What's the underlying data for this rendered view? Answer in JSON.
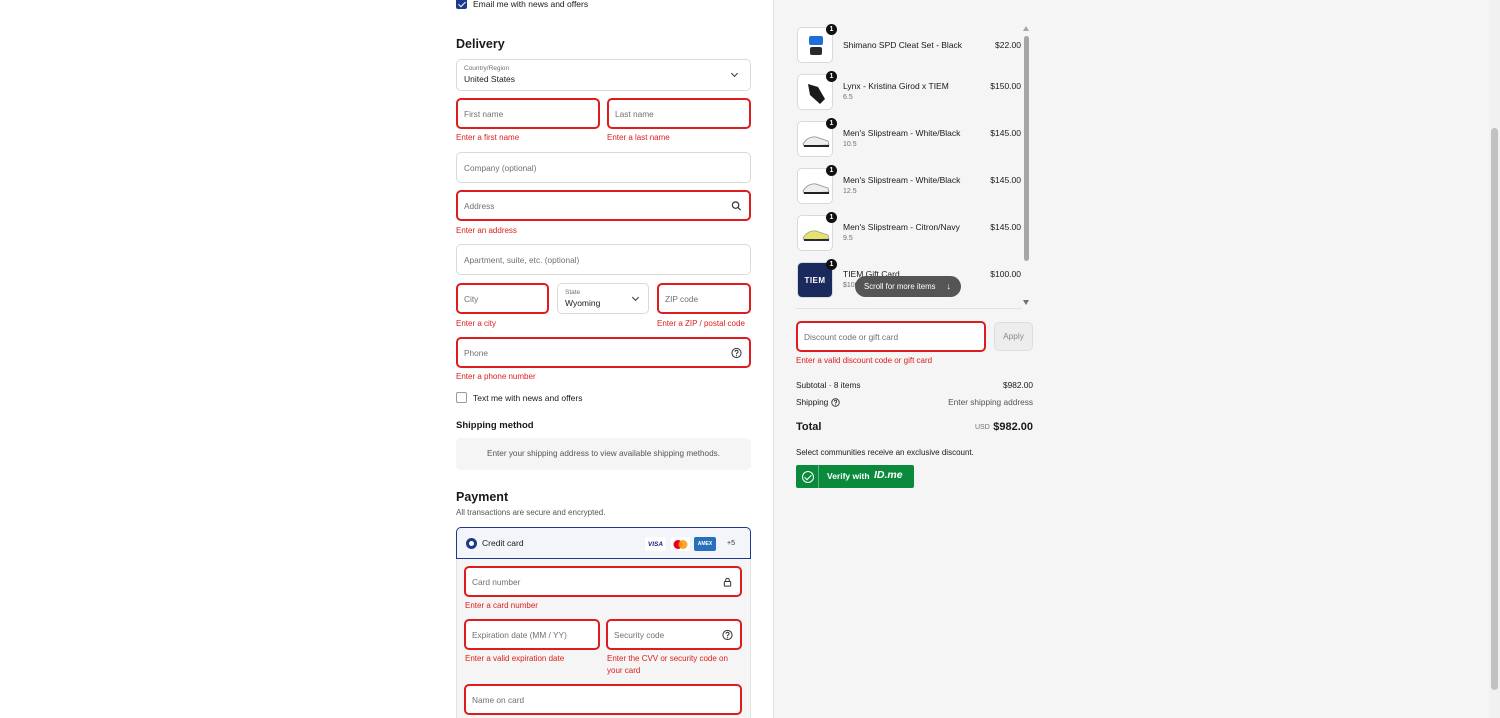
{
  "contact": {
    "email_optin_label": "Email me with news and offers",
    "email_optin_checked": true
  },
  "delivery": {
    "heading": "Delivery",
    "country": {
      "label": "Country/Region",
      "value": "United States"
    },
    "first_name": {
      "placeholder": "First name",
      "error": "Enter a first name"
    },
    "last_name": {
      "placeholder": "Last name",
      "error": "Enter a last name"
    },
    "company": {
      "placeholder": "Company (optional)"
    },
    "address": {
      "placeholder": "Address",
      "error": "Enter an address"
    },
    "apartment": {
      "placeholder": "Apartment, suite, etc. (optional)"
    },
    "city": {
      "placeholder": "City",
      "error": "Enter a city"
    },
    "state": {
      "label": "State",
      "value": "Wyoming"
    },
    "zip": {
      "placeholder": "ZIP code",
      "error": "Enter a ZIP / postal code"
    },
    "phone": {
      "placeholder": "Phone",
      "error": "Enter a phone number"
    },
    "sms_optin_label": "Text me with news and offers",
    "sms_optin_checked": false
  },
  "shipping": {
    "heading": "Shipping method",
    "message": "Enter your shipping address to view available shipping methods."
  },
  "payment": {
    "heading": "Payment",
    "subheading": "All transactions are secure and encrypted.",
    "method_label": "Credit card",
    "card_brands": [
      "VISA",
      "MC",
      "AMEX",
      "+5"
    ],
    "card_number": {
      "placeholder": "Card number",
      "error": "Enter a card number"
    },
    "expiration": {
      "placeholder": "Expiration date (MM / YY)",
      "error": "Enter a valid expiration date"
    },
    "security": {
      "placeholder": "Security code",
      "error_line1": "Enter the CVV or security code on",
      "error_line2": "your card"
    },
    "name_on_card": {
      "placeholder": "Name on card"
    }
  },
  "cart": {
    "items": [
      {
        "name": "Shimano SPD Cleat Set - Black",
        "variant": "",
        "price": "$22.00",
        "qty": "1",
        "thumb": "cleats-icon"
      },
      {
        "name": "Lynx - Kristina Girod x TIEM",
        "variant": "6.5",
        "price": "$150.00",
        "qty": "1",
        "thumb": "black-shoe-icon"
      },
      {
        "name": "Men's Slipstream - White/Black",
        "variant": "10.5",
        "price": "$145.00",
        "qty": "1",
        "thumb": "white-shoe-icon"
      },
      {
        "name": "Men's Slipstream - White/Black",
        "variant": "12.5",
        "price": "$145.00",
        "qty": "1",
        "thumb": "white-shoe-icon"
      },
      {
        "name": "Men's Slipstream - Citron/Navy",
        "variant": "9.5",
        "price": "$145.00",
        "qty": "1",
        "thumb": "yellow-shoe-icon"
      },
      {
        "name": "TIEM Gift Card",
        "variant": "$100",
        "price": "$100.00",
        "qty": "1",
        "thumb": "gift-card-icon",
        "thumb_text": "TIEM"
      }
    ],
    "scroll_hint": "Scroll for more items",
    "discount": {
      "placeholder": "Discount code or gift card",
      "error": "Enter a valid discount code or gift card",
      "apply_label": "Apply"
    },
    "subtotal_label": "Subtotal · 8 items",
    "subtotal_value": "$982.00",
    "shipping_label": "Shipping",
    "shipping_value": "Enter shipping address",
    "total_label": "Total",
    "total_currency": "USD",
    "total_value": "$982.00",
    "community_text": "Select communities receive an exclusive discount.",
    "verify_label": "Verify with",
    "verify_brand": "ID.me"
  },
  "colors": {
    "accent": "#1b3a8c",
    "error": "#dd1d1d",
    "verify": "#0b8a3c"
  }
}
